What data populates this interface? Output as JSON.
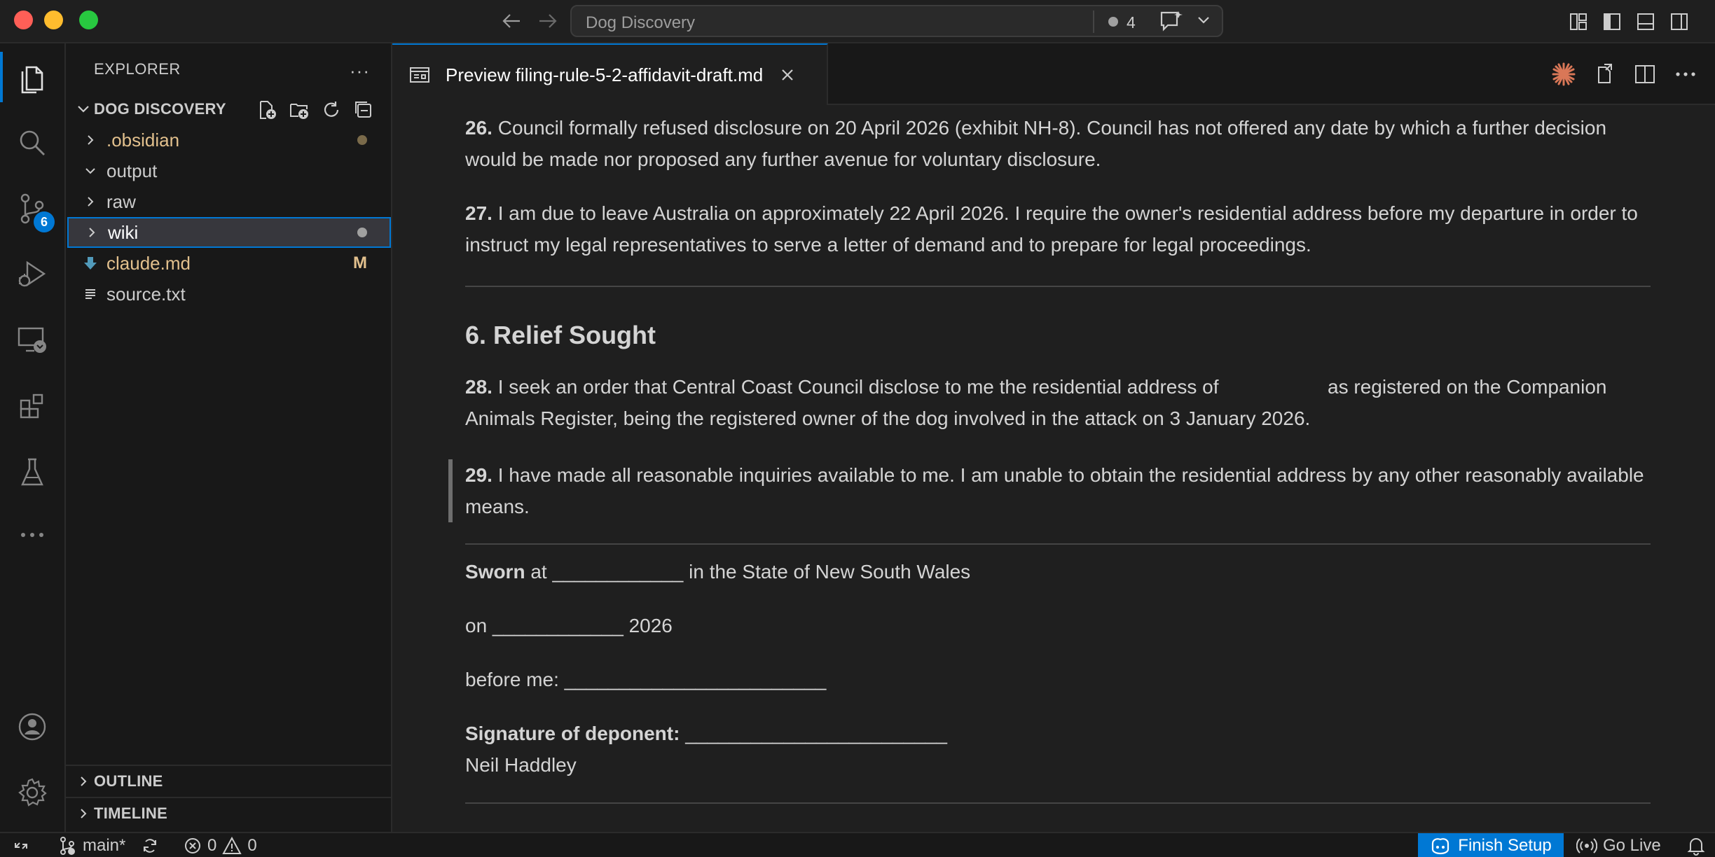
{
  "window": {
    "title": "Dog Discovery",
    "notification_count": "4"
  },
  "explorer": {
    "header": "EXPLORER",
    "more": "···",
    "root_folder": "DOG DISCOVERY",
    "items": [
      {
        "label": ".obsidian",
        "type": "folder",
        "expanded": false,
        "decoration": "dot"
      },
      {
        "label": "output",
        "type": "folder",
        "expanded": true,
        "decoration": ""
      },
      {
        "label": "raw",
        "type": "folder",
        "expanded": false,
        "decoration": ""
      },
      {
        "label": "wiki",
        "type": "folder",
        "expanded": false,
        "decoration": "dot",
        "selected": true
      },
      {
        "label": "claude.md",
        "type": "file",
        "icon": "download-arrow-icon",
        "decoration": "M"
      },
      {
        "label": "source.txt",
        "type": "file",
        "icon": "text-lines-icon",
        "decoration": ""
      }
    ],
    "outline_label": "OUTLINE",
    "timeline_label": "TIMELINE"
  },
  "activity": {
    "scm_badge": "6"
  },
  "editor": {
    "tab_label": "Preview filing-rule-5-2-affidavit-draft.md"
  },
  "document": {
    "p26_num": "26.",
    "p26_text": " Council formally refused disclosure on 20 April 2026 (exhibit NH-8). Council has not offered any date by which a further decision would be made nor proposed any further avenue for voluntary disclosure.",
    "p27_num": "27.",
    "p27_text": " I am due to leave Australia on approximately 22 April 2026. I require the owner's residential address before my departure in order to instruct my legal representatives to serve a letter of demand and to prepare for legal proceedings.",
    "heading": "6. Relief Sought",
    "p28_num": "28.",
    "p28_text_a": " I seek an order that Central Coast Council disclose to me the residential address of ",
    "p28_text_b": " as registered on the Companion Animals Register, being the registered owner of the dog involved in the attack on 3 January 2026.",
    "p29_num": "29.",
    "p29_text": " I have made all reasonable inquiries available to me. I am unable to obtain the residential address by any other reasonably available means.",
    "sworn_label": "Sworn",
    "sworn_text": " at ____________ in the State of New South Wales",
    "on_text": "on ____________ 2026",
    "before_text": "before me: ________________________",
    "signature_label": "Signature of deponent:",
    "signature_line": " ________________________",
    "deponent_name": "Neil Haddley"
  },
  "statusbar": {
    "branch": "main*",
    "errors": "0",
    "warnings": "0",
    "finish_setup": "Finish Setup",
    "go_live": "Go Live"
  },
  "colors": {
    "accent": "#0078d4",
    "modified": "#e2c08d",
    "editor_bg": "#1f1f1f",
    "sidebar_bg": "#181818"
  }
}
